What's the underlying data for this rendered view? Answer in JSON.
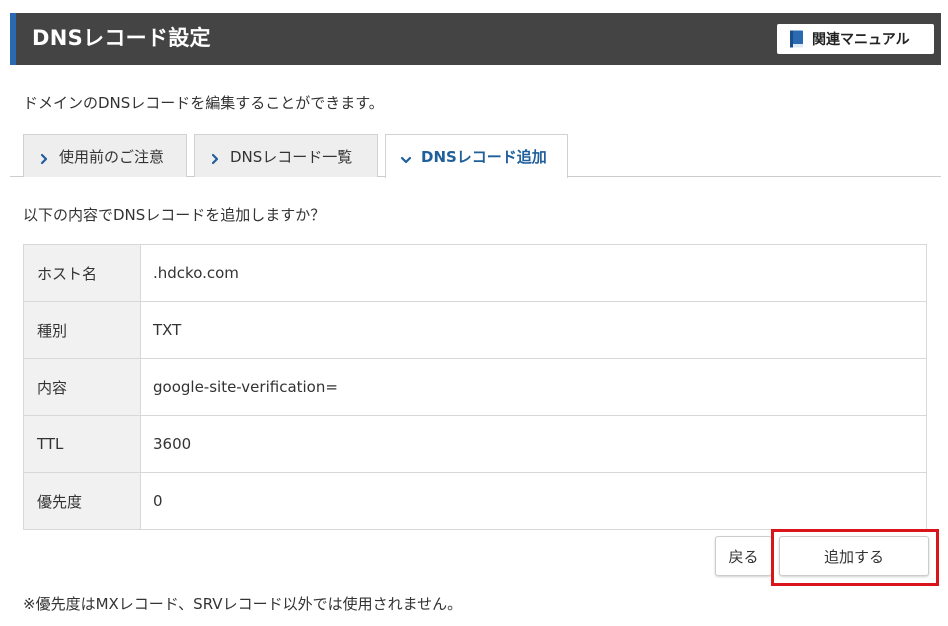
{
  "header": {
    "title": "DNSレコード設定",
    "manual_label": "関連マニュアル",
    "manual_icon": "book-icon"
  },
  "description": "ドメインのDNSレコードを編集することができます。",
  "tabs": [
    {
      "label": "使用前のご注意",
      "active": false
    },
    {
      "label": "DNSレコード一覧",
      "active": false
    },
    {
      "label": "DNSレコード追加",
      "active": true
    }
  ],
  "confirm_text": "以下の内容でDNSレコードを追加しますか？",
  "record": [
    {
      "label": "ホスト名",
      "value": ".hdcko.com"
    },
    {
      "label": "種別",
      "value": "TXT"
    },
    {
      "label": "内容",
      "value": "google-site-verification="
    },
    {
      "label": "TTL",
      "value": "3600"
    },
    {
      "label": "優先度",
      "value": "0"
    }
  ],
  "buttons": {
    "back_label": "戻る",
    "add_label": "追加する"
  },
  "note": "※優先度はMXレコード、SRVレコード以外では使用されません。",
  "colors": {
    "header_bg": "#444444",
    "header_accent": "#2a6ab0",
    "active_tab_text": "#1f5f9b",
    "highlight": "#d9141b"
  }
}
